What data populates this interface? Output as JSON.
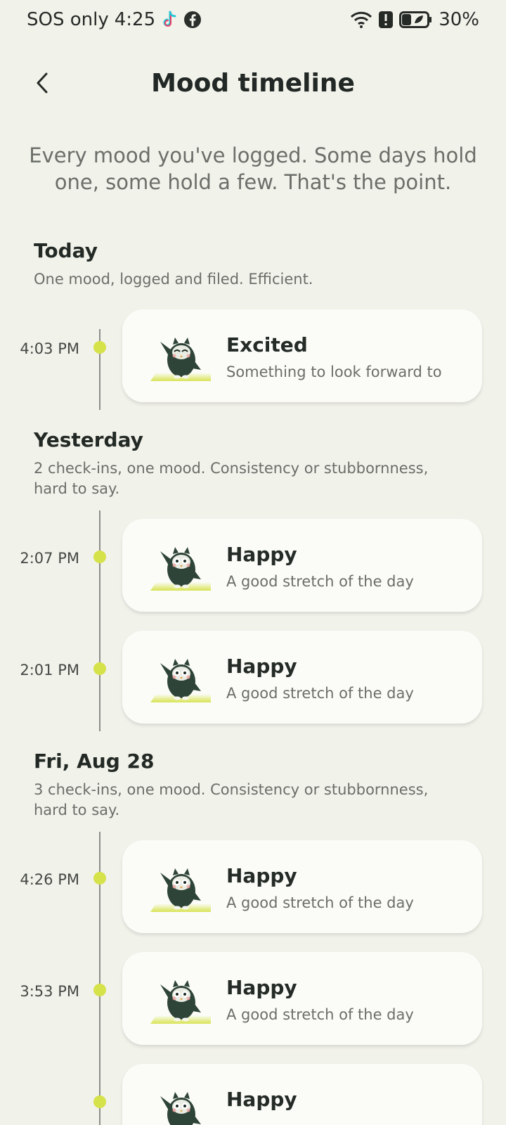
{
  "status_bar": {
    "carrier": "SOS only",
    "time": "4:25",
    "battery": "30%",
    "icons": [
      "tiktok-icon",
      "facebook-icon",
      "wifi-icon",
      "alert-icon",
      "battery-icon"
    ]
  },
  "header": {
    "title": "Mood timeline",
    "back_icon": "chevron-left-icon"
  },
  "intro": "Every mood you've logged. Some days hold one, some hold a few. That's the point.",
  "colors": {
    "background": "#f1f2ea",
    "card": "#fbfcf8",
    "dot": "#d6e24a",
    "mascot_body": "#2f4438",
    "mascot_glow": "#d6e24a"
  },
  "days": [
    {
      "title": "Today",
      "subtitle": "One mood, logged and filed. Efficient.",
      "entries": [
        {
          "time": "4:03 PM",
          "mood": "Excited",
          "desc": "Something to look forward to"
        }
      ]
    },
    {
      "title": "Yesterday",
      "subtitle": "2 check-ins, one mood. Consistency or stubbornness, hard to say.",
      "entries": [
        {
          "time": "2:07 PM",
          "mood": "Happy",
          "desc": "A good stretch of the day"
        },
        {
          "time": "2:01 PM",
          "mood": "Happy",
          "desc": "A good stretch of the day"
        }
      ]
    },
    {
      "title": "Fri, Aug 28",
      "subtitle": "3 check-ins, one mood. Consistency or stubbornness, hard to say.",
      "entries": [
        {
          "time": "4:26 PM",
          "mood": "Happy",
          "desc": "A good stretch of the day"
        },
        {
          "time": "3:53 PM",
          "mood": "Happy",
          "desc": "A good stretch of the day"
        },
        {
          "time": "",
          "mood": "Happy",
          "desc": ""
        }
      ]
    }
  ]
}
